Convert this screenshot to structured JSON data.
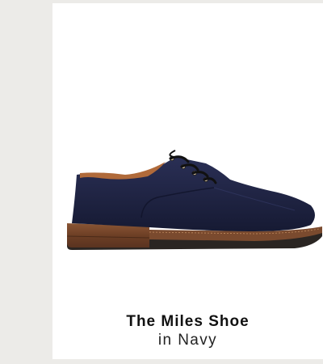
{
  "product": {
    "name": "The Miles Shoe",
    "variant": "in Navy",
    "image_icon": "navy-suede-derby-shoe",
    "colors": {
      "suede": "#1f2340",
      "sole": "#7a4a2e",
      "outsole": "#2a2522"
    }
  }
}
